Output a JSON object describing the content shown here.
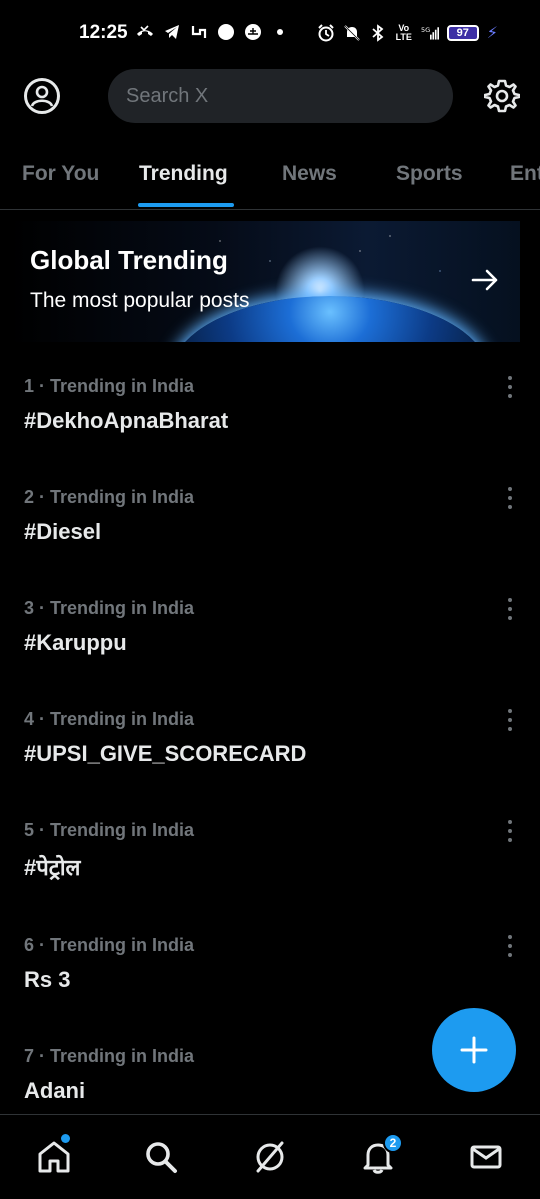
{
  "status_bar": {
    "time": "12:25",
    "battery_level": "97",
    "left_icons": [
      "missed-call-icon",
      "telegram-icon",
      "app-icon",
      "circle-icon",
      "emblem-icon",
      "dot-icon"
    ],
    "right_icons": [
      "alarm-icon",
      "mute-icon",
      "bluetooth-icon",
      "volte-icon",
      "signal-5g-icon",
      "battery-icon",
      "charging-icon"
    ]
  },
  "header": {
    "search_placeholder": "Search X"
  },
  "tabs": [
    {
      "label": "For You"
    },
    {
      "label": "Trending"
    },
    {
      "label": "News"
    },
    {
      "label": "Sports"
    },
    {
      "label": "Ent"
    }
  ],
  "active_tab": "Trending",
  "banner": {
    "title": "Global Trending",
    "subtitle": "The most popular posts"
  },
  "trends": [
    {
      "meta": "1 · Trending in India",
      "name": "#DekhoApnaBharat"
    },
    {
      "meta": "2 · Trending in India",
      "name": "#Diesel"
    },
    {
      "meta": "3 · Trending in India",
      "name": "#Karuppu"
    },
    {
      "meta": "4 · Trending in India",
      "name": "#UPSI_GIVE_SCORECARD"
    },
    {
      "meta": "5 · Trending in India",
      "name": "#पेट्रोल"
    },
    {
      "meta": "6 · Trending in India",
      "name": "Rs 3"
    },
    {
      "meta": "7 · Trending in India",
      "name": "Adani"
    }
  ],
  "bottom_nav": {
    "notifications_badge": "2"
  },
  "colors": {
    "accent": "#1d9bf0",
    "background": "#000000",
    "muted_text": "#71767b",
    "primary_text": "#e7e9ea"
  }
}
